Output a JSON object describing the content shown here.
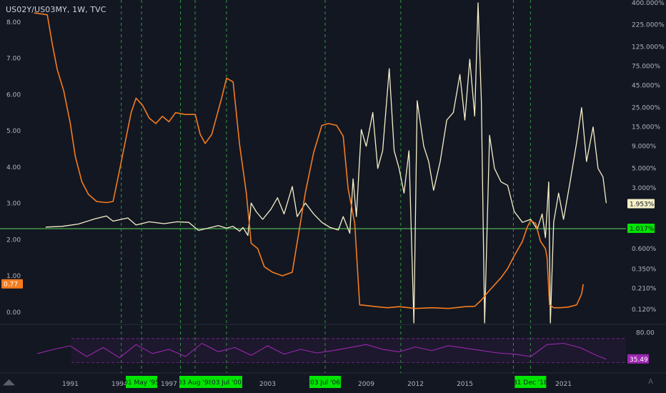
{
  "header": {
    "symbol_title": "US02Y/US03MY, 1W, TVC"
  },
  "colors": {
    "background": "#131722",
    "ratio_line": "#f57c1f",
    "vol_line": "#f5f0c8",
    "hline": "#4caf50",
    "rsi_line": "#9c27b0",
    "event_line": "#2e9e3b",
    "event_label_bg": "#00e600",
    "axis_text": "#b2b5be"
  },
  "chart_data": [
    {
      "type": "line",
      "name": "main-pane",
      "x_ticks": [
        "1991",
        "1994",
        "1997",
        "2003",
        "2009",
        "2012",
        "2015",
        "2021"
      ],
      "x_range": [
        1988.2,
        2024.8
      ],
      "left_axis": {
        "ticks": [
          "8.00",
          "7.00",
          "6.00",
          "5.00",
          "4.00",
          "3.00",
          "2.00",
          "1.00",
          "0.00"
        ],
        "range": [
          -0.3,
          8.45
        ]
      },
      "right_axis": {
        "scale": "log",
        "ticks": [
          "400.000%",
          "225.000%",
          "125.000%",
          "75.000%",
          "45.000%",
          "25.000%",
          "15.000%",
          "9.000%",
          "5.000%",
          "3.000%",
          "1.953%",
          "1.017%",
          "0.600%",
          "0.350%",
          "0.210%",
          "0.120%"
        ],
        "tick_values": [
          400,
          225,
          125,
          75,
          45,
          25,
          15,
          9,
          5,
          3,
          1.953,
          1.017,
          0.6,
          0.35,
          0.21,
          0.12
        ]
      },
      "series": [
        {
          "axis": "left",
          "points": [
            [
              1988.8,
              8.25
            ],
            [
              1989.6,
              8.2
            ],
            [
              1989.9,
              7.4
            ],
            [
              1990.2,
              6.7
            ],
            [
              1990.6,
              6.1
            ],
            [
              1991.0,
              5.2
            ],
            [
              1991.3,
              4.3
            ],
            [
              1991.7,
              3.6
            ],
            [
              1992.1,
              3.25
            ],
            [
              1992.6,
              3.05
            ],
            [
              1993.2,
              3.02
            ],
            [
              1993.6,
              3.05
            ],
            [
              1993.9,
              3.7
            ],
            [
              1994.3,
              4.6
            ],
            [
              1994.7,
              5.5
            ],
            [
              1995.0,
              5.9
            ],
            [
              1995.4,
              5.7
            ],
            [
              1995.8,
              5.35
            ],
            [
              1996.2,
              5.2
            ],
            [
              1996.6,
              5.4
            ],
            [
              1997.0,
              5.25
            ],
            [
              1997.4,
              5.5
            ],
            [
              1998.0,
              5.45
            ],
            [
              1998.6,
              5.45
            ],
            [
              1998.9,
              4.9
            ],
            [
              1999.2,
              4.65
            ],
            [
              1999.6,
              4.9
            ],
            [
              1999.9,
              5.4
            ],
            [
              2000.2,
              5.9
            ],
            [
              2000.5,
              6.45
            ],
            [
              2000.9,
              6.35
            ],
            [
              2001.3,
              4.6
            ],
            [
              2001.7,
              3.3
            ],
            [
              2002.0,
              1.9
            ],
            [
              2002.4,
              1.75
            ],
            [
              2002.8,
              1.25
            ],
            [
              2003.3,
              1.1
            ],
            [
              2003.9,
              1.0
            ],
            [
              2004.5,
              1.1
            ],
            [
              2004.9,
              2.2
            ],
            [
              2005.3,
              3.3
            ],
            [
              2005.8,
              4.4
            ],
            [
              2006.3,
              5.15
            ],
            [
              2006.7,
              5.2
            ],
            [
              2007.2,
              5.15
            ],
            [
              2007.6,
              4.85
            ],
            [
              2007.9,
              3.4
            ],
            [
              2008.3,
              2.45
            ],
            [
              2008.6,
              0.2
            ],
            [
              2009.0,
              0.18
            ],
            [
              2009.6,
              0.15
            ],
            [
              2010.3,
              0.12
            ],
            [
              2011.0,
              0.15
            ],
            [
              2012.0,
              0.1
            ],
            [
              2013.0,
              0.12
            ],
            [
              2014.0,
              0.1
            ],
            [
              2015.0,
              0.15
            ],
            [
              2015.6,
              0.16
            ],
            [
              2016.0,
              0.33
            ],
            [
              2016.4,
              0.55
            ],
            [
              2016.8,
              0.75
            ],
            [
              2017.2,
              0.95
            ],
            [
              2017.6,
              1.2
            ],
            [
              2018.0,
              1.55
            ],
            [
              2018.5,
              1.95
            ],
            [
              2018.8,
              2.35
            ],
            [
              2019.0,
              2.52
            ],
            [
              2019.3,
              2.45
            ],
            [
              2019.6,
              1.95
            ],
            [
              2019.9,
              1.75
            ],
            [
              2020.0,
              1.5
            ],
            [
              2020.15,
              0.2
            ],
            [
              2020.4,
              0.12
            ],
            [
              2020.8,
              0.12
            ],
            [
              2021.3,
              0.14
            ],
            [
              2021.8,
              0.2
            ],
            [
              2022.1,
              0.5
            ],
            [
              2022.2,
              0.77
            ]
          ]
        },
        {
          "axis": "right",
          "points": [
            [
              1989.5,
              1.06
            ],
            [
              1990.5,
              1.08
            ],
            [
              1991.5,
              1.15
            ],
            [
              1992.5,
              1.32
            ],
            [
              1993.2,
              1.42
            ],
            [
              1993.6,
              1.24
            ],
            [
              1994.5,
              1.35
            ],
            [
              1995.0,
              1.12
            ],
            [
              1995.8,
              1.22
            ],
            [
              1996.7,
              1.16
            ],
            [
              1997.5,
              1.22
            ],
            [
              1998.2,
              1.2
            ],
            [
              1998.8,
              0.97
            ],
            [
              1999.3,
              1.02
            ],
            [
              2000.0,
              1.1
            ],
            [
              2000.5,
              1.03
            ],
            [
              2000.9,
              1.08
            ],
            [
              2001.3,
              0.95
            ],
            [
              2001.5,
              1.05
            ],
            [
              2001.8,
              0.85
            ],
            [
              2002.0,
              2.0
            ],
            [
              2002.3,
              1.6
            ],
            [
              2002.7,
              1.3
            ],
            [
              2003.2,
              1.7
            ],
            [
              2003.6,
              2.3
            ],
            [
              2004.0,
              1.5
            ],
            [
              2004.5,
              3.1
            ],
            [
              2004.8,
              1.4
            ],
            [
              2005.3,
              2.0
            ],
            [
              2005.8,
              1.5
            ],
            [
              2006.3,
              1.2
            ],
            [
              2006.8,
              1.05
            ],
            [
              2007.3,
              0.98
            ],
            [
              2007.6,
              1.4
            ],
            [
              2008.0,
              0.9
            ],
            [
              2008.2,
              3.8
            ],
            [
              2008.4,
              1.4
            ],
            [
              2008.7,
              14
            ],
            [
              2009.0,
              9
            ],
            [
              2009.4,
              22
            ],
            [
              2009.7,
              5
            ],
            [
              2010.0,
              8
            ],
            [
              2010.4,
              70
            ],
            [
              2010.7,
              8
            ],
            [
              2011.0,
              5
            ],
            [
              2011.3,
              2.6
            ],
            [
              2011.6,
              8
            ],
            [
              2011.9,
              0.05
            ],
            [
              2012.1,
              30
            ],
            [
              2012.5,
              9
            ],
            [
              2012.8,
              6
            ],
            [
              2013.1,
              2.8
            ],
            [
              2013.5,
              6
            ],
            [
              2013.9,
              18
            ],
            [
              2014.3,
              22
            ],
            [
              2014.7,
              60
            ],
            [
              2015.0,
              18
            ],
            [
              2015.3,
              90
            ],
            [
              2015.6,
              20
            ],
            [
              2015.8,
              500
            ],
            [
              2016.0,
              30
            ],
            [
              2016.2,
              0.05
            ],
            [
              2016.5,
              12
            ],
            [
              2016.8,
              5
            ],
            [
              2017.2,
              3.5
            ],
            [
              2017.6,
              3.2
            ],
            [
              2018.0,
              1.6
            ],
            [
              2018.5,
              1.2
            ],
            [
              2019.0,
              1.3
            ],
            [
              2019.4,
              1.0
            ],
            [
              2019.7,
              1.5
            ],
            [
              2019.9,
              0.8
            ],
            [
              2020.1,
              3.5
            ],
            [
              2020.2,
              0.05
            ],
            [
              2020.4,
              1.2
            ],
            [
              2020.7,
              2.6
            ],
            [
              2021.0,
              1.3
            ],
            [
              2021.4,
              3.5
            ],
            [
              2021.8,
              10
            ],
            [
              2022.1,
              25
            ],
            [
              2022.4,
              6
            ],
            [
              2022.8,
              15
            ],
            [
              2023.1,
              5
            ],
            [
              2023.4,
              4
            ],
            [
              2023.6,
              2.0
            ]
          ]
        }
      ],
      "hline": {
        "axis": "right",
        "value": 1.017
      },
      "last_values": {
        "left": "0.77",
        "right_vol": "1.953%",
        "right_hline": "1.017%"
      },
      "event_lines": [
        {
          "x": 1995.33,
          "label": "01 May '95"
        },
        {
          "x": 1998.59,
          "label": "03 Aug '98"
        },
        {
          "x": 2000.5,
          "label": "03 Jul '00"
        },
        {
          "x": 2006.5,
          "label": "03 Jul '06"
        },
        {
          "x": 2018.99,
          "label": "31 Dec '18"
        }
      ],
      "other_event_lines": [
        1994.1,
        1997.7,
        2011.1,
        2017.95
      ]
    },
    {
      "type": "line",
      "name": "rsi-pane",
      "y_ticks": [
        "80.00"
      ],
      "y_range": [
        15,
        90
      ],
      "bands": [
        70,
        30
      ],
      "last_value": "35.49",
      "series": [
        {
          "points": [
            [
              1989.0,
              45
            ],
            [
              1990.0,
              52
            ],
            [
              1991.0,
              58
            ],
            [
              1992.0,
              40
            ],
            [
              1993.0,
              55
            ],
            [
              1994.0,
              38
            ],
            [
              1995.0,
              60
            ],
            [
              1996.0,
              45
            ],
            [
              1997.0,
              52
            ],
            [
              1998.0,
              40
            ],
            [
              1999.0,
              62
            ],
            [
              2000.0,
              48
            ],
            [
              2001.0,
              55
            ],
            [
              2002.0,
              42
            ],
            [
              2003.0,
              58
            ],
            [
              2004.0,
              44
            ],
            [
              2005.0,
              52
            ],
            [
              2006.0,
              46
            ],
            [
              2007.0,
              50
            ],
            [
              2008.0,
              55
            ],
            [
              2009.0,
              60
            ],
            [
              2010.0,
              52
            ],
            [
              2011.0,
              48
            ],
            [
              2012.0,
              56
            ],
            [
              2013.0,
              50
            ],
            [
              2014.0,
              58
            ],
            [
              2015.0,
              54
            ],
            [
              2016.0,
              50
            ],
            [
              2017.0,
              46
            ],
            [
              2018.0,
              44
            ],
            [
              2019.0,
              40
            ],
            [
              2020.0,
              60
            ],
            [
              2021.0,
              62
            ],
            [
              2022.0,
              55
            ],
            [
              2023.0,
              42
            ],
            [
              2023.6,
              35.49
            ]
          ]
        }
      ]
    }
  ],
  "nav_label": "A"
}
